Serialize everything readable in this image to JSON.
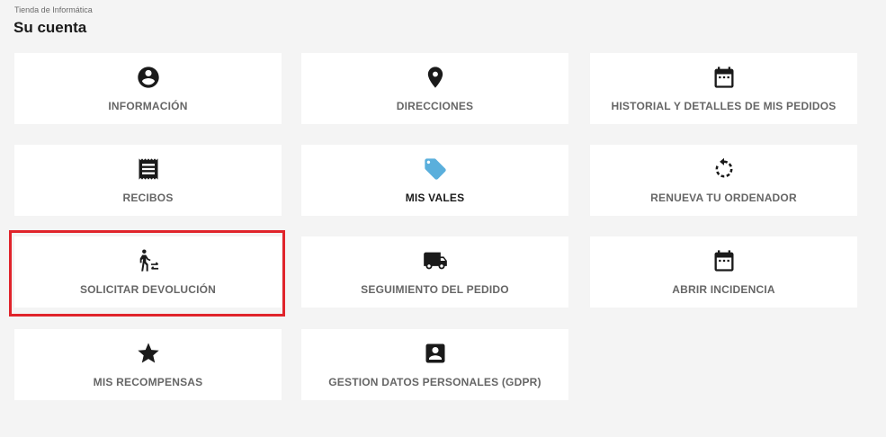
{
  "header": {
    "breadcrumb": "Tienda de Informática",
    "title": "Su cuenta"
  },
  "cards": {
    "informacion": {
      "label": "INFORMACIÓN",
      "icon": "account-circle-icon"
    },
    "direcciones": {
      "label": "DIRECCIONES",
      "icon": "location-pin-icon"
    },
    "historial": {
      "label": "HISTORIAL Y DETALLES DE MIS PEDIDOS",
      "icon": "calendar-icon"
    },
    "recibos": {
      "label": "RECIBOS",
      "icon": "receipt-icon"
    },
    "vales": {
      "label": "MIS VALES",
      "icon": "tag-icon"
    },
    "renueva": {
      "label": "RENUEVA TU ORDENADOR",
      "icon": "restore-icon"
    },
    "devolucion": {
      "label": "SOLICITAR DEVOLUCIÓN",
      "icon": "walk-exchange-icon"
    },
    "seguimiento": {
      "label": "SEGUIMIENTO DEL PEDIDO",
      "icon": "truck-icon"
    },
    "incidencia": {
      "label": "ABRIR INCIDENCIA",
      "icon": "calendar-icon"
    },
    "recompensas": {
      "label": "MIS RECOMPENSAS",
      "icon": "star-icon"
    },
    "gdpr": {
      "label": "GESTION DATOS PERSONALES (GDPR)",
      "icon": "account-box-icon"
    }
  },
  "colors": {
    "background": "#f4f4f4",
    "card": "#ffffff",
    "label": "#666666",
    "icon": "#1a1a1a",
    "tag_accent": "#5aafdc",
    "highlight": "#e0242b"
  }
}
